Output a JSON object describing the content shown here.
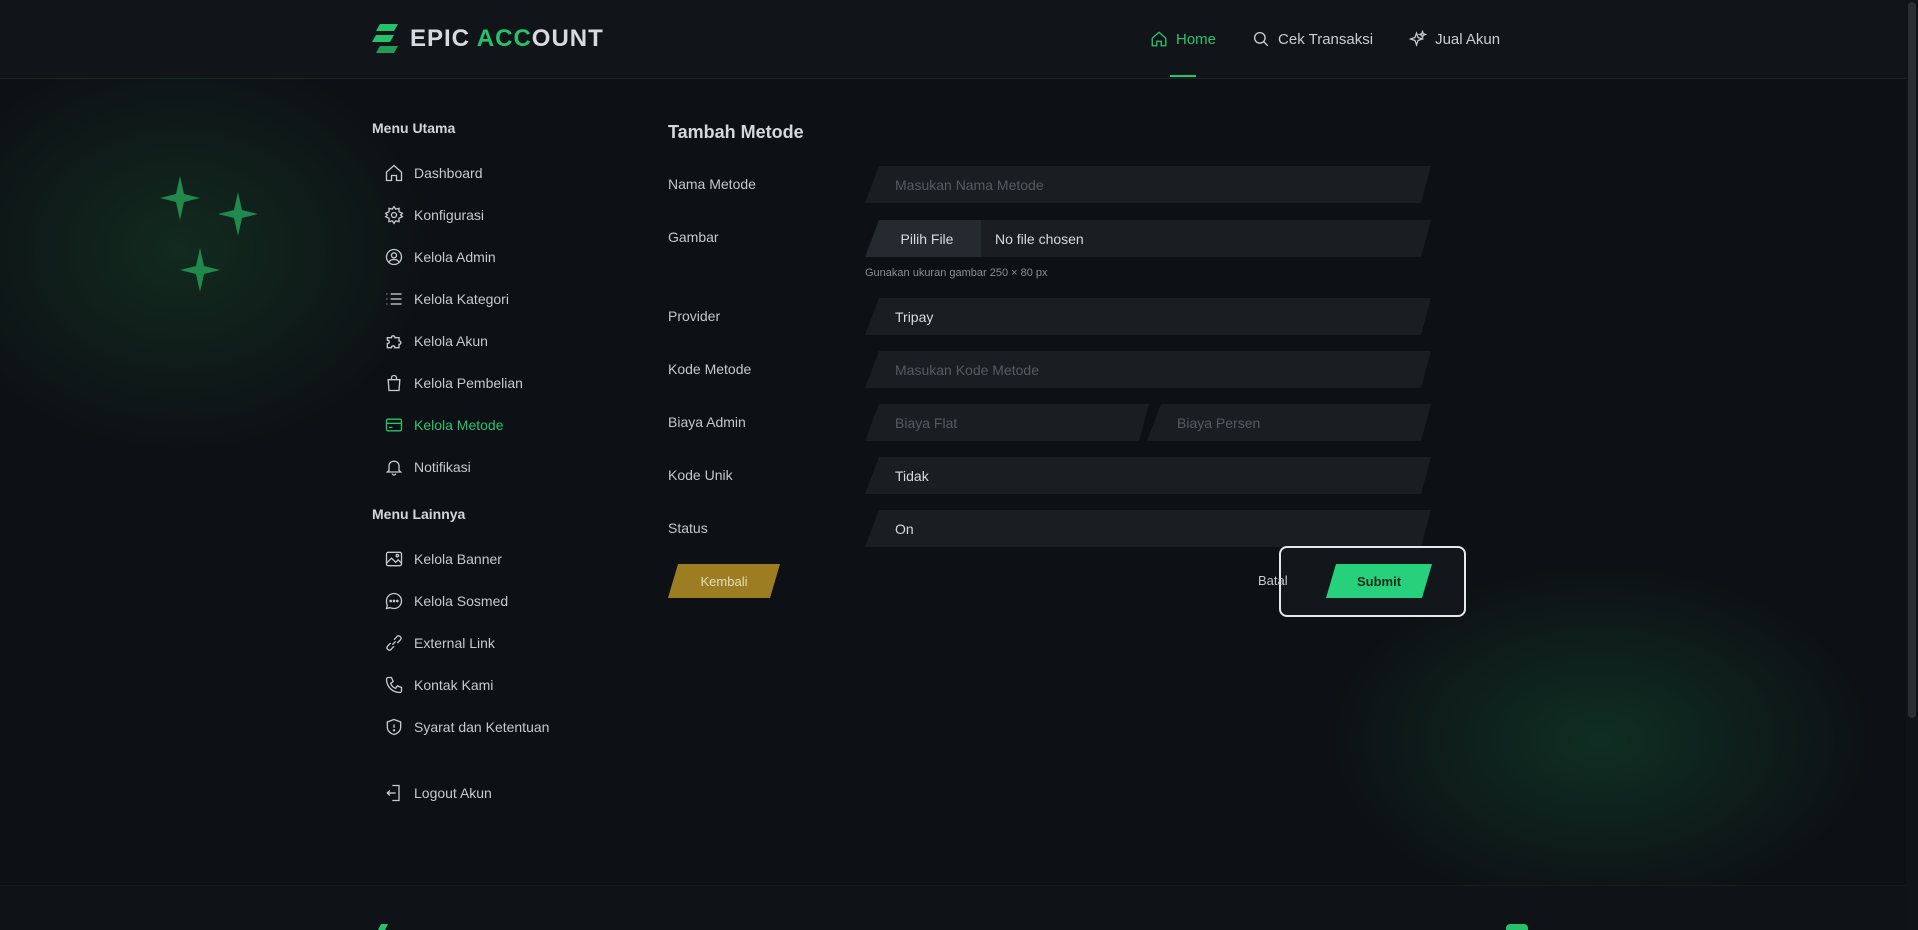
{
  "brand": {
    "part1": "EPIC ",
    "part2": "ACC",
    "part3": "OUNT"
  },
  "nav": [
    {
      "label": "Home",
      "icon": "home-icon",
      "active": true
    },
    {
      "label": "Cek Transaksi",
      "icon": "search-icon",
      "active": false
    },
    {
      "label": "Jual Akun",
      "icon": "sparkle-icon",
      "active": false
    }
  ],
  "sidebar": {
    "main_heading": "Menu Utama",
    "main_items": [
      {
        "label": "Dashboard",
        "icon": "home-icon"
      },
      {
        "label": "Konfigurasi",
        "icon": "gear-icon"
      },
      {
        "label": "Kelola Admin",
        "icon": "user-circle-icon"
      },
      {
        "label": "Kelola Kategori",
        "icon": "list-icon"
      },
      {
        "label": "Kelola Akun",
        "icon": "puzzle-icon"
      },
      {
        "label": "Kelola Pembelian",
        "icon": "shopping-bag-icon"
      },
      {
        "label": "Kelola Metode",
        "icon": "credit-card-icon",
        "active": true
      },
      {
        "label": "Notifikasi",
        "icon": "bell-icon"
      }
    ],
    "other_heading": "Menu Lainnya",
    "other_items": [
      {
        "label": "Kelola Banner",
        "icon": "image-icon"
      },
      {
        "label": "Kelola Sosmed",
        "icon": "chat-icon"
      },
      {
        "label": "External Link",
        "icon": "link-icon"
      },
      {
        "label": "Kontak Kami",
        "icon": "phone-icon"
      },
      {
        "label": "Syarat dan Ketentuan",
        "icon": "shield-icon"
      }
    ],
    "logout": {
      "label": "Logout Akun",
      "icon": "logout-icon"
    }
  },
  "form": {
    "title": "Tambah Metode",
    "nama_label": "Nama Metode",
    "nama_placeholder": "Masukan Nama Metode",
    "gambar_label": "Gambar",
    "file_button": "Pilih File",
    "file_status": "No file chosen",
    "gambar_hint": "Gunakan ukuran gambar 250 × 80 px",
    "provider_label": "Provider",
    "provider_value": "Tripay",
    "kode_label": "Kode Metode",
    "kode_placeholder": "Masukan Kode Metode",
    "biaya_label": "Biaya Admin",
    "biaya_flat_placeholder": "Biaya Flat",
    "biaya_persen_placeholder": "Biaya Persen",
    "kode_unik_label": "Kode Unik",
    "kode_unik_value": "Tidak",
    "status_label": "Status",
    "status_value": "On",
    "back_label": "Kembali",
    "cancel_label": "Batal",
    "submit_label": "Submit"
  },
  "colors": {
    "accent": "#27c46e",
    "background": "#0d1014",
    "field": "#1a1e23",
    "back_button": "#9c7d22",
    "submit_button": "#27d07a"
  }
}
